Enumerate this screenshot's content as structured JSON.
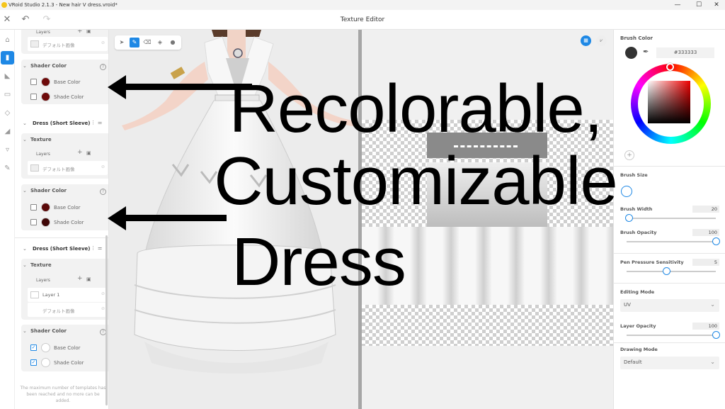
{
  "window": {
    "title": "VRoid Studio 2.1.3 - New hair V dress.vroid*",
    "minimize_glyph": "—",
    "maximize_glyph": "☐",
    "close_glyph": "✕"
  },
  "header": {
    "title": "Texture Editor",
    "close_glyph": "✕",
    "undo_glyph": "↶",
    "redo_glyph": "↷"
  },
  "rail": {
    "items": [
      {
        "icon": "shirt-icon",
        "glyph": "⌂"
      },
      {
        "icon": "dress-icon",
        "glyph": "▮",
        "active": true
      },
      {
        "icon": "shoe-icon",
        "glyph": "◣"
      },
      {
        "icon": "bag-icon",
        "glyph": "▭"
      },
      {
        "icon": "shield-icon",
        "glyph": "◇"
      },
      {
        "icon": "boot-icon",
        "glyph": "◢"
      },
      {
        "icon": "tie-icon",
        "glyph": "▿"
      },
      {
        "icon": "brush-icon",
        "glyph": "✎"
      }
    ]
  },
  "left_panel": {
    "layers_label": "Layers",
    "texture_label": "Texture",
    "shader_color_label": "Shader Color",
    "base_color_label": "Base Color",
    "shade_color_label": "Shade Color",
    "default_image_label": "デフォルト画像",
    "layer1_label": "Layer 1",
    "section1_title": "Dress (Short Sleeve)",
    "section2_title": "Dress (Short Sleeve)",
    "footnote": "The maximum number of templates has been reached and no more can be added.",
    "colors": {
      "dark_red": "#6e0b0b",
      "darker_red": "#3f0707",
      "white": "#ffffff"
    }
  },
  "draw_tools": [
    {
      "name": "select-tool-icon",
      "glyph": "➤"
    },
    {
      "name": "pen-tool-icon",
      "glyph": "✎",
      "active": true
    },
    {
      "name": "eraser-tool-icon",
      "glyph": "⌫"
    },
    {
      "name": "fill-tool-icon",
      "glyph": "◈"
    },
    {
      "name": "blur-tool-icon",
      "glyph": "●"
    }
  ],
  "right_panel": {
    "brush_color_label": "Brush Color",
    "brush_color_value": "#333333",
    "brush_swatch_color": "#333333",
    "brush_size_label": "Brush Size",
    "brush_width_label": "Brush Width",
    "brush_width_value": "20",
    "brush_width_level": 0.03,
    "brush_opacity_label": "Brush Opacity",
    "brush_opacity_value": "100",
    "brush_opacity_level": 1.0,
    "pen_pressure_label": "Pen Pressure Sensitivity",
    "pen_pressure_value": "5",
    "pen_pressure_level": 0.45,
    "editing_mode_label": "Editing Mode",
    "editing_mode_value": "UV",
    "layer_opacity_label": "Layer Opacity",
    "layer_opacity_value": "100",
    "layer_opacity_level": 1.0,
    "drawing_mode_label": "Drawing Mode",
    "drawing_mode_value": "Default",
    "accent": "#1e88e5"
  },
  "overlay": {
    "line1": "Recolorable,",
    "line2": "Customizable",
    "line3": "Dress"
  }
}
